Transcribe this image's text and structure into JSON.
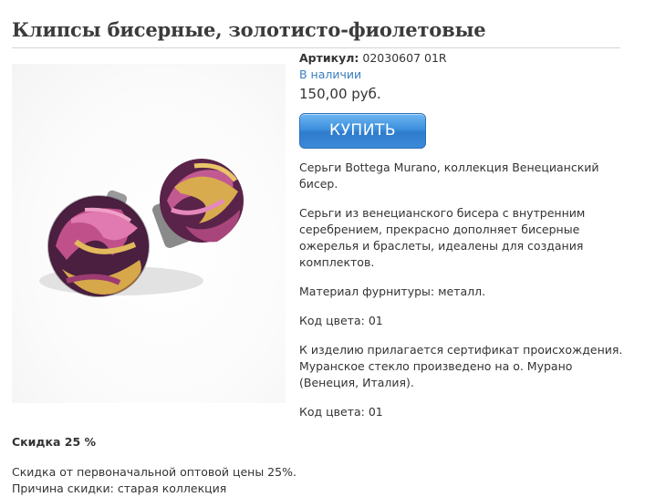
{
  "product": {
    "title": "Клипсы бисерные, золотисто-фиолетовые",
    "sku_label": "Артикул:",
    "sku_value": "02030607 01R",
    "availability": "В наличии",
    "price": "150,00 руб.",
    "buy_label": "КУПИТЬ",
    "image_alt": "beaded-clip-earrings-photo"
  },
  "description": [
    "Серьги Bottega Murano, коллекция Венецианский бисер.",
    "Серьги из венецианского бисера с внутренним серебрением, прекрасно дополняет бисерные ожерелья и браслеты, идеалены для создания комплектов.",
    "Материал фурнитуры: металл.",
    "Код цвета: 01",
    "К изделию прилагается сертификат происхождения. Муранское стекло произведено на о. Мурано (Венеция, Италия).",
    "Код цвета: 01"
  ],
  "discount": {
    "title": "Скидка 25 %",
    "text": "Скидка от первоначальной оптовой цены 25%.",
    "reason": "Причина скидки: старая коллекция"
  },
  "colors": {
    "link": "#3a7dbd",
    "button": "#3d8fdc",
    "bead_pink": "#c0508a",
    "bead_gold": "#d6a84a",
    "bead_purple": "#4a1f3f"
  }
}
